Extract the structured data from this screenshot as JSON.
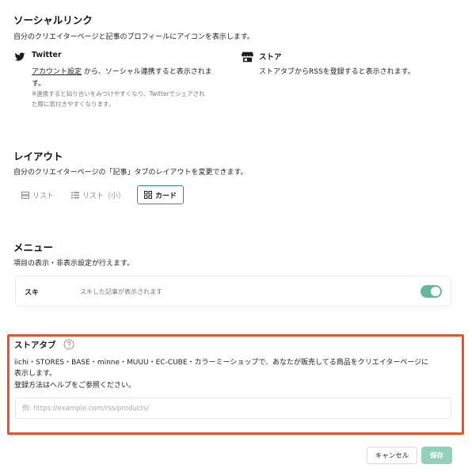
{
  "social": {
    "title": "ソーシャルリンク",
    "description": "自分のクリエイターページと記事のプロフィールにアイコンを表示します。",
    "twitter": {
      "label": "Twitter",
      "link_text": "アカウント設定",
      "line1_rest": "から、ソーシャル連携すると表示されま",
      "line2": "す。",
      "note1": "※連携すると知り合いをみつけやすくなり、Twitterでシェアされ",
      "note2": "た際に気付きやすくなります。",
      "icon": "twitter-bird-icon"
    },
    "store": {
      "label": "ストア",
      "description": "ストアタブからRSSを登録すると表示されます。",
      "icon": "store-icon"
    }
  },
  "layout": {
    "title": "レイアウト",
    "description": "自分のクリエイターページの「記事」タブのレイアウトを変更できます。",
    "options": [
      {
        "label": "リスト",
        "icon": "list-icon"
      },
      {
        "label": "リスト（小）",
        "icon": "small-list-icon"
      },
      {
        "label": "カード",
        "icon": "card-grid-icon"
      }
    ],
    "selected": "カード"
  },
  "menu": {
    "title": "メニュー",
    "description": "項目の表示・非表示設定が行えます。",
    "item_label": "スキ",
    "item_description": "スキした記事が表示されます",
    "toggle_on": true
  },
  "store_tab": {
    "title": "ストアタブ",
    "help_icon": "help-circle-icon",
    "line1": "iichi・STORES・BASE・minne・MUUU・EC-CUBE・カラーミーショップで、あなたが販売してる商品をクリエイターページに",
    "line2": "表示します。",
    "line3": "登録方法はヘルプをご参照ください。",
    "input_value": "",
    "input_placeholder": "例: https://example.com/rss/products/",
    "highlight_color": "#e0552f"
  },
  "footer": {
    "cancel_label": "キャンセル",
    "save_label": "保存"
  },
  "colors": {
    "accent": "#62b89a",
    "save_button": "#93cfbb"
  }
}
